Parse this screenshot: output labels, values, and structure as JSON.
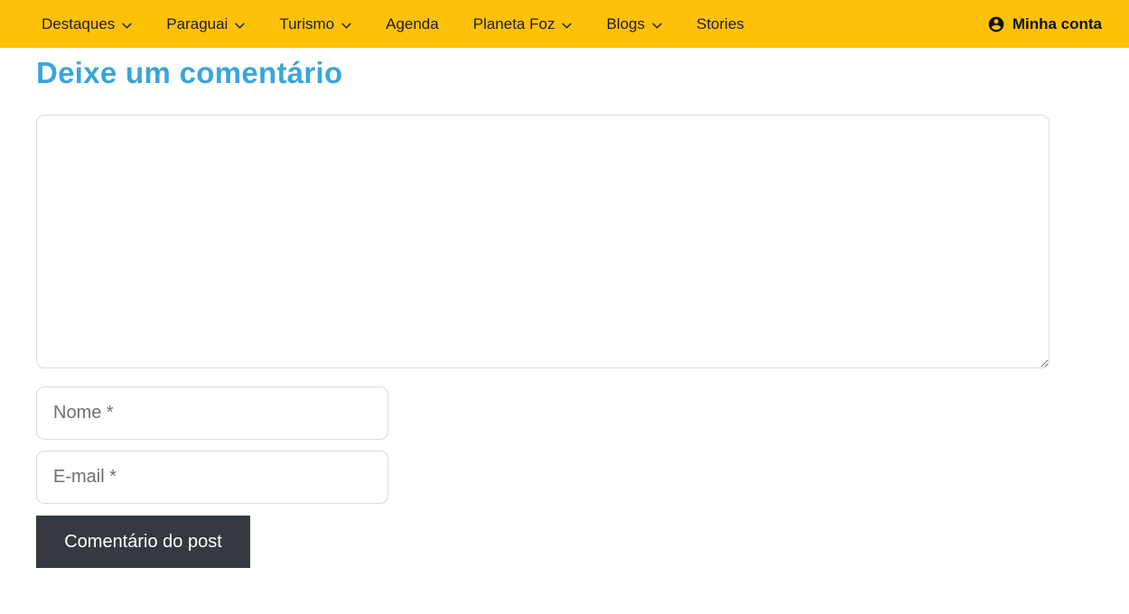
{
  "nav": {
    "bg_color": "#ffc107",
    "items": [
      {
        "label": "Destaques",
        "has_dropdown": true
      },
      {
        "label": "Paraguai",
        "has_dropdown": true
      },
      {
        "label": "Turismo",
        "has_dropdown": true
      },
      {
        "label": "Agenda",
        "has_dropdown": false
      },
      {
        "label": "Planeta Foz",
        "has_dropdown": true
      },
      {
        "label": "Blogs",
        "has_dropdown": true
      },
      {
        "label": "Stories",
        "has_dropdown": false
      }
    ],
    "account": {
      "label": "Minha conta",
      "icon": "account-circle-icon"
    },
    "dropdown_icon": "chevron-down-icon"
  },
  "comment_form": {
    "title": "Deixe um comentário",
    "title_color": "#3aa5d9",
    "comment_textarea": {
      "value": "",
      "placeholder": ""
    },
    "name_input": {
      "value": "",
      "placeholder": "Nome *"
    },
    "email_input": {
      "value": "",
      "placeholder": "E-mail *"
    },
    "submit_button": {
      "label": "Comentário do post",
      "bg_color": "#343a40",
      "text_color": "#ffffff"
    }
  }
}
